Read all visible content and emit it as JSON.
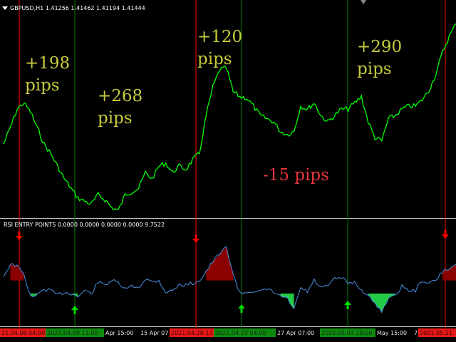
{
  "chart_info": {
    "symbol_line": "GBPUSD,H1  1.41256 1.41462 1.41194 1.41444",
    "indicator_line": "RSI ENTRY POINTS 0.0000 0.0000 0.0000 0.0000 9.7522"
  },
  "annotations": [
    {
      "id": "trade1",
      "line1": "+198",
      "line2": "pips",
      "color": "#c8cc3c"
    },
    {
      "id": "trade2",
      "line1": "+268",
      "line2": "pips",
      "color": "#c8cc3c"
    },
    {
      "id": "trade3",
      "line1": "+120",
      "line2": "pips",
      "color": "#c8cc3c"
    },
    {
      "id": "trade4",
      "line1": "-15 pips",
      "line2": "",
      "color": "#e8343c"
    },
    {
      "id": "trade5",
      "line1": "+290",
      "line2": "pips",
      "color": "#c8cc3c"
    }
  ],
  "time_axis": [
    {
      "label": "21.04.06 04:00",
      "style": "red"
    },
    {
      "label": "2021.04.09 11:00",
      "style": "green"
    },
    {
      "label": "Apr 15:00",
      "style": "plain"
    },
    {
      "label": "15 Apr 07",
      "style": "plain"
    },
    {
      "label": "2021.04.20 13",
      "style": "red"
    },
    {
      "label": "2021.04.23 04:00",
      "style": "green"
    },
    {
      "label": "27 Apr 07:00",
      "style": "plain"
    },
    {
      "label": "2021.05.03 10:00",
      "style": "green"
    },
    {
      "label": "May 15:00",
      "style": "plain"
    },
    {
      "label": "7",
      "style": "plain"
    },
    {
      "label": "2021.05.11",
      "style": "red"
    }
  ],
  "signals": {
    "sell": [
      {
        "time": "2021.04.06 04:00"
      },
      {
        "time": "2021.04.20 13:00"
      },
      {
        "time": "2021.05.11"
      }
    ],
    "buy": [
      {
        "time": "2021.04.09 11:00"
      },
      {
        "time": "2021.04.23 04:00"
      },
      {
        "time": "2021.05.03 10:00"
      }
    ]
  },
  "colors": {
    "background": "#000000",
    "price_line": "#00ff00",
    "rsi_line": "#4a90e2",
    "sell_line": "#ff0000",
    "buy_line": "#008000",
    "overbought_fill": "#8b0000",
    "oversold_fill": "#22cc44",
    "sell_arrow": "#ff0000",
    "buy_arrow": "#00dd00"
  },
  "chart_data": {
    "type": "line",
    "series": [
      {
        "values": [
          1.377,
          1.3822,
          1.388,
          1.39,
          1.3872,
          1.382,
          1.377,
          1.374,
          1.37,
          1.366,
          1.363,
          1.36,
          1.359,
          1.358,
          1.361,
          1.3595,
          1.357,
          1.356,
          1.361,
          1.362,
          1.363,
          1.368,
          1.366,
          1.37,
          1.371,
          1.368,
          1.37,
          1.369,
          1.372,
          1.374,
          1.386,
          1.395,
          1.4005,
          1.401,
          1.3935,
          1.392,
          1.3915,
          1.389,
          1.386,
          1.385,
          1.384,
          1.381,
          1.38,
          1.381,
          1.389,
          1.388,
          1.39,
          1.386,
          1.384,
          1.386,
          1.388,
          1.388,
          1.39,
          1.392,
          1.384,
          1.379,
          1.378,
          1.385,
          1.386,
          1.388,
          1.389,
          1.389,
          1.391,
          1.394,
          1.399,
          1.406,
          1.411,
          1.415
        ]
      }
    ],
    "rsi": [
      48,
      56,
      55,
      49,
      34,
      35,
      39,
      38,
      35,
      37,
      36,
      34,
      38,
      36,
      44,
      42,
      45,
      43,
      39,
      41,
      40,
      46,
      44,
      45,
      37,
      38,
      42,
      42,
      43,
      45,
      51,
      58,
      63,
      68,
      49,
      36,
      37,
      38,
      37,
      39,
      37,
      34,
      33,
      25,
      40,
      37,
      45,
      40,
      41,
      46,
      47,
      43,
      44,
      38,
      35,
      29,
      24,
      33,
      35,
      41,
      38,
      38,
      45,
      43,
      45,
      51,
      53,
      56
    ],
    "rsi_levels": {
      "overbought": 70,
      "oversold": 30
    }
  }
}
